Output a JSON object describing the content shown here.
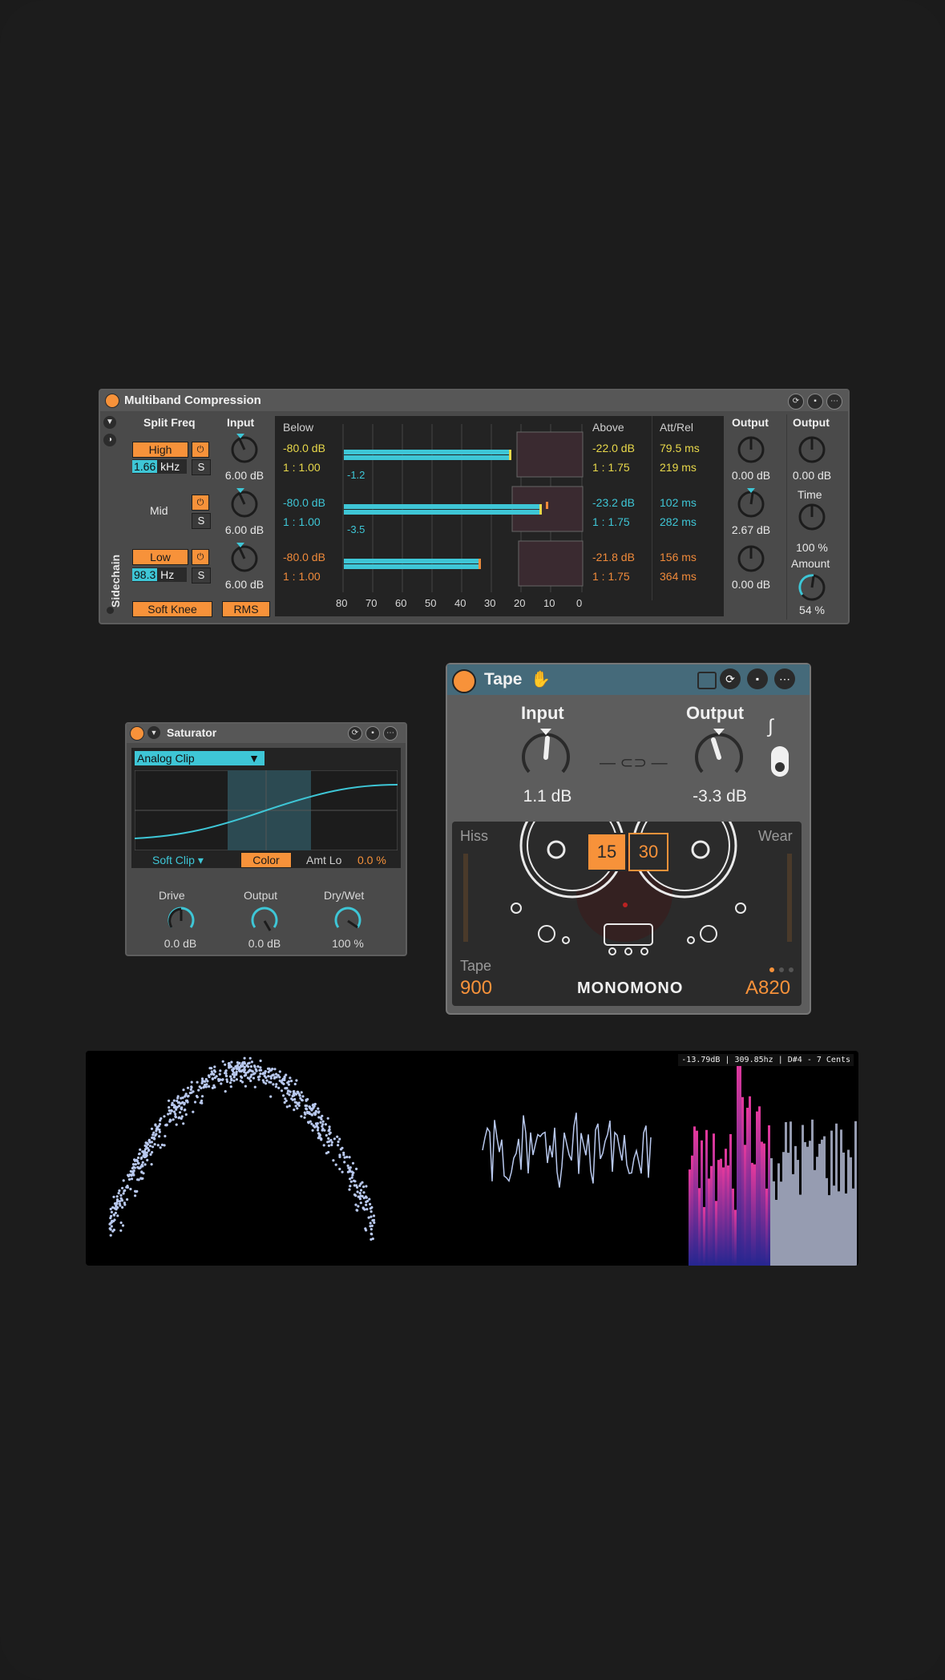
{
  "multiband": {
    "title": "Multiband Compression",
    "sidechain_label": "Sidechain",
    "split_freq_label": "Split Freq",
    "input_label": "Input",
    "high_label": "High",
    "mid_label": "Mid",
    "low_label": "Low",
    "high_freq_value": "1.66",
    "high_freq_unit": "kHz",
    "low_freq_value": "98.3",
    "low_freq_unit": "Hz",
    "solo_label": "S",
    "input_high": "6.00 dB",
    "input_mid": "6.00 dB",
    "input_low": "6.00 dB",
    "soft_knee_label": "Soft Knee",
    "rms_label": "RMS",
    "below_label": "Below",
    "above_label": "Above",
    "attrel_label": "Att/Rel",
    "bands": [
      {
        "below_thresh": "-80.0 dB",
        "below_ratio": "1 : 1.00",
        "gr": "-1.2",
        "above_thresh": "-22.0 dB",
        "above_ratio": "1 : 1.75",
        "attack": "79.5 ms",
        "release": "219 ms",
        "color": "#e8d84a"
      },
      {
        "below_thresh": "-80.0 dB",
        "below_ratio": "1 : 1.00",
        "gr": "-3.5",
        "above_thresh": "-23.2 dB",
        "above_ratio": "1 : 1.75",
        "attack": "102 ms",
        "release": "282 ms",
        "color": "#3ec6d6"
      },
      {
        "below_thresh": "-80.0 dB",
        "below_ratio": "1 : 1.00",
        "gr": "",
        "above_thresh": "-21.8 dB",
        "above_ratio": "1 : 1.75",
        "attack": "156 ms",
        "release": "364 ms",
        "color": "#f08a3a"
      }
    ],
    "scale_ticks": [
      "80",
      "70",
      "60",
      "50",
      "40",
      "30",
      "20",
      "10",
      "0"
    ],
    "output_label": "Output",
    "output_high": "0.00 dB",
    "output_mid": "2.67 dB",
    "output_low": "0.00 dB",
    "master_output_label": "Output",
    "master_output": "0.00 dB",
    "time_label": "Time",
    "time_value": "100 %",
    "amount_label": "Amount",
    "amount_value": "54 %",
    "level_fill": [
      0.55,
      0.68,
      0.48
    ]
  },
  "saturator": {
    "title": "Saturator",
    "mode": "Analog Clip",
    "waveshape": "Soft Clip",
    "color_label": "Color",
    "amt_lo_label": "Amt Lo",
    "amt_lo_value": "0.0 %",
    "drive_label": "Drive",
    "drive_value": "0.0 dB",
    "output_label": "Output",
    "output_value": "0.0 dB",
    "drywet_label": "Dry/Wet",
    "drywet_value": "100 %"
  },
  "tape": {
    "title": "Tape",
    "input_label": "Input",
    "input_value": "1.1 dB",
    "output_label": "Output",
    "output_value": "-3.3 dB",
    "hiss_label": "Hiss",
    "wear_label": "Wear",
    "speed_a": "15",
    "speed_b": "30",
    "tape_label": "Tape",
    "tape_value": "900",
    "brand": "MONOMONO",
    "model": "A820"
  },
  "visualizer": {
    "readout": "-13.79dB | 309.85hz | D#4 - 7 Cents"
  }
}
